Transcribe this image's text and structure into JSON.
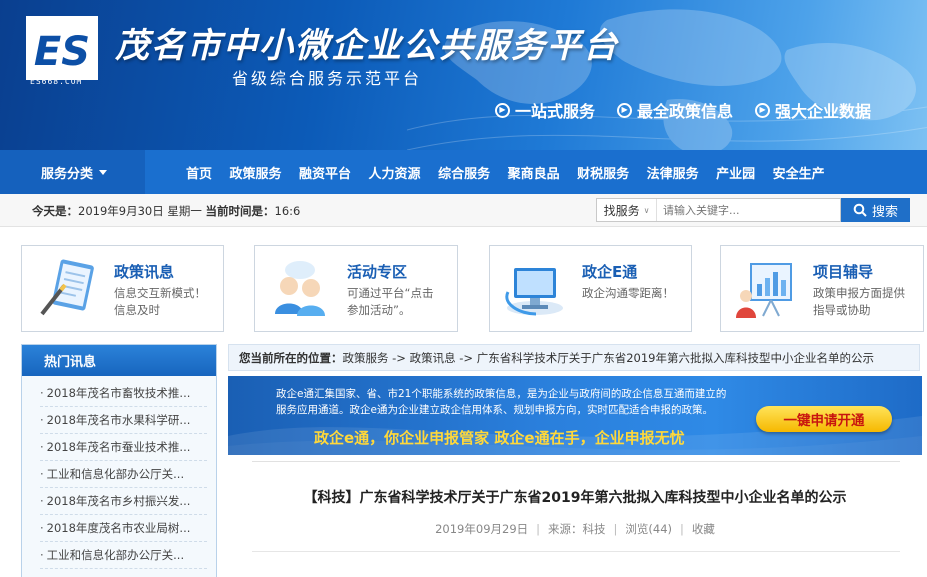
{
  "header": {
    "logo_text": "ES",
    "logo_url": "ES668.COM",
    "site_title": "茂名市中小微企业公共服务平台",
    "site_subtitle": "省级综合服务示范平台",
    "features": [
      "一站式服务",
      "最全政策信息",
      "强大企业数据"
    ]
  },
  "nav": {
    "service_menu": "服务分类",
    "items": [
      "首页",
      "政策服务",
      "融资平台",
      "人力资源",
      "综合服务",
      "聚商良品",
      "财税服务",
      "法律服务",
      "产业园",
      "安全生产"
    ]
  },
  "infobar": {
    "today_label": "今天是：",
    "today_value": "2019年9月30日 星期一",
    "time_label": "当前时间是：",
    "time_value": "16:6",
    "search_scope": "找服务",
    "search_placeholder": "请输入关键字...",
    "search_button": "搜索"
  },
  "cards": [
    {
      "title": "政策讯息",
      "desc1": "信息交互新模式！",
      "desc2": "信息及时",
      "icon": "notepad-icon"
    },
    {
      "title": "活动专区",
      "desc1": "可通过平台“点击",
      "desc2": "参加活动”。",
      "icon": "people-chat-icon"
    },
    {
      "title": "政企E通",
      "desc1": "政企沟通零距离！",
      "desc2": "",
      "icon": "monitor-icon"
    },
    {
      "title": "项目辅导",
      "desc1": "政策申报方面提供",
      "desc2": "指导或协助",
      "icon": "chart-board-icon"
    }
  ],
  "sidebar": {
    "title": "热门讯息",
    "items": [
      "2018年茂名市畜牧技术推...",
      "2018年茂名市水果科学研...",
      "2018年茂名市蚕业技术推...",
      "工业和信息化部办公厅关...",
      "2018年茂名市乡村振兴发...",
      "2018年度茂名市农业局树...",
      "工业和信息化部办公厅关..."
    ]
  },
  "breadcrumb": {
    "label": "您当前所在的位置：",
    "path": "政策服务  ->  政策讯息  ->  广东省科学技术厅关于广东省2019年第六批拟入库科技型中小企业名单的公示"
  },
  "promo": {
    "text": "政企e通汇集国家、省、市21个职能系统的政策信息，是为企业与政府间的政企信息互通而建立的服务应用通道。政企e通为企业建立政企信用体系、规划申报方向，实时匹配适合申报的政策。",
    "slogan": "政企e通，你企业申报管家     政企e通在手，企业申报无忧",
    "button": "一键申请开通"
  },
  "article": {
    "title": "【科技】广东省科学技术厅关于广东省2019年第六批拟入库科技型中小企业名单的公示",
    "date": "2019年09月29日",
    "source": "来源：科技",
    "views": "浏览(44)",
    "favorite": "收藏"
  },
  "colors": {
    "brand_blue": "#1a6fcf",
    "title_blue": "#1a5fb4",
    "promo_yellow": "#ffd83a",
    "button_red": "#c8150f"
  }
}
